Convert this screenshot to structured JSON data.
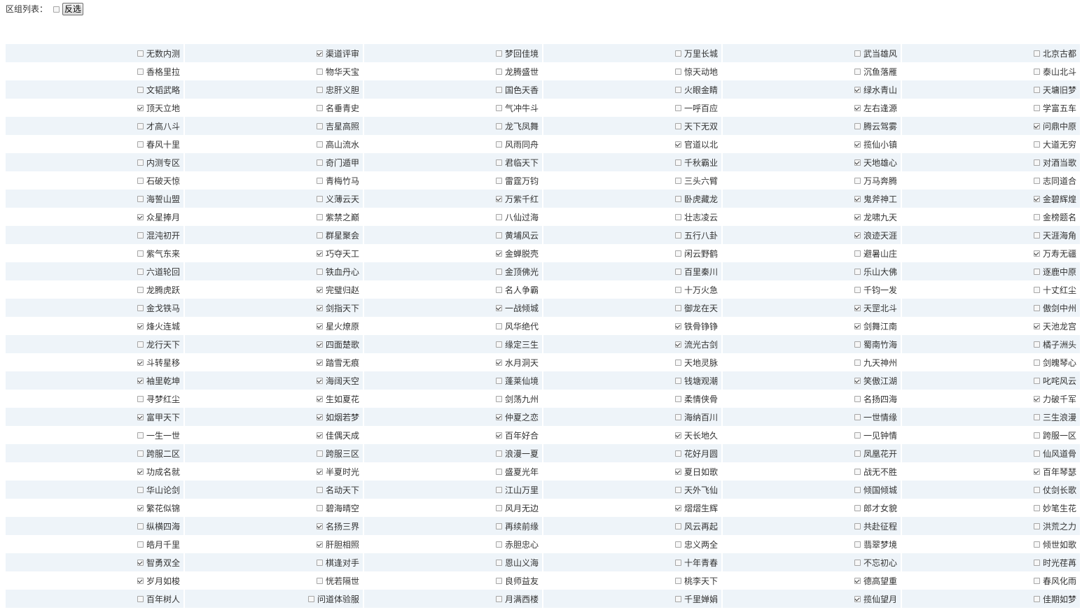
{
  "header": {
    "title": "区组列表：",
    "select_all_checked": false,
    "invert_button_label": "反选"
  },
  "rows": [
    [
      {
        "name": "无数内测",
        "checked": false
      },
      {
        "name": "渠道评审",
        "checked": true
      },
      {
        "name": "梦回佳境",
        "checked": false
      },
      {
        "name": "万里长城",
        "checked": false
      },
      {
        "name": "武当雄风",
        "checked": false
      },
      {
        "name": "北京古都",
        "checked": false
      }
    ],
    [
      {
        "name": "香格里拉",
        "checked": false
      },
      {
        "name": "物华天宝",
        "checked": false
      },
      {
        "name": "龙腾盛世",
        "checked": false
      },
      {
        "name": "惊天动地",
        "checked": false
      },
      {
        "name": "沉鱼落雁",
        "checked": false
      },
      {
        "name": "泰山北斗",
        "checked": false
      }
    ],
    [
      {
        "name": "文韬武略",
        "checked": false
      },
      {
        "name": "忠肝义胆",
        "checked": false
      },
      {
        "name": "国色天香",
        "checked": false
      },
      {
        "name": "火眼金睛",
        "checked": false
      },
      {
        "name": "绿水青山",
        "checked": true
      },
      {
        "name": "天墉旧梦",
        "checked": false
      }
    ],
    [
      {
        "name": "顶天立地",
        "checked": true
      },
      {
        "name": "名垂青史",
        "checked": false
      },
      {
        "name": "气冲牛斗",
        "checked": false
      },
      {
        "name": "一呼百应",
        "checked": false
      },
      {
        "name": "左右逢源",
        "checked": true
      },
      {
        "name": "学富五车",
        "checked": false
      }
    ],
    [
      {
        "name": "才高八斗",
        "checked": false
      },
      {
        "name": "吉星高照",
        "checked": false
      },
      {
        "name": "龙飞凤舞",
        "checked": false
      },
      {
        "name": "天下无双",
        "checked": false
      },
      {
        "name": "腾云驾雾",
        "checked": false
      },
      {
        "name": "问鼎中原",
        "checked": true
      }
    ],
    [
      {
        "name": "春风十里",
        "checked": false
      },
      {
        "name": "高山流水",
        "checked": false
      },
      {
        "name": "风雨同舟",
        "checked": false
      },
      {
        "name": "官道以北",
        "checked": true
      },
      {
        "name": "揽仙小镇",
        "checked": true
      },
      {
        "name": "大道无穷",
        "checked": false
      }
    ],
    [
      {
        "name": "内测专区",
        "checked": false
      },
      {
        "name": "奇门遁甲",
        "checked": false
      },
      {
        "name": "君临天下",
        "checked": false
      },
      {
        "name": "千秋霸业",
        "checked": false
      },
      {
        "name": "天地雄心",
        "checked": true
      },
      {
        "name": "对酒当歌",
        "checked": false
      }
    ],
    [
      {
        "name": "石破天惊",
        "checked": false
      },
      {
        "name": "青梅竹马",
        "checked": false
      },
      {
        "name": "雷霆万钧",
        "checked": false
      },
      {
        "name": "三头六臂",
        "checked": false
      },
      {
        "name": "万马奔腾",
        "checked": false
      },
      {
        "name": "志同道合",
        "checked": false
      }
    ],
    [
      {
        "name": "海誓山盟",
        "checked": false
      },
      {
        "name": "义薄云天",
        "checked": false
      },
      {
        "name": "万紫千红",
        "checked": true
      },
      {
        "name": "卧虎藏龙",
        "checked": false
      },
      {
        "name": "鬼斧神工",
        "checked": true
      },
      {
        "name": "金碧辉煌",
        "checked": true
      }
    ],
    [
      {
        "name": "众星捧月",
        "checked": true
      },
      {
        "name": "紫禁之巅",
        "checked": false
      },
      {
        "name": "八仙过海",
        "checked": false
      },
      {
        "name": "壮志凌云",
        "checked": false
      },
      {
        "name": "龙啸九天",
        "checked": true
      },
      {
        "name": "金榜题名",
        "checked": false
      }
    ],
    [
      {
        "name": "混沌初开",
        "checked": false
      },
      {
        "name": "群星聚会",
        "checked": false
      },
      {
        "name": "黄埔风云",
        "checked": false
      },
      {
        "name": "五行八卦",
        "checked": false
      },
      {
        "name": "浪迹天涯",
        "checked": true
      },
      {
        "name": "天涯海角",
        "checked": false
      }
    ],
    [
      {
        "name": "紫气东来",
        "checked": false
      },
      {
        "name": "巧夺天工",
        "checked": true
      },
      {
        "name": "金蝉脱壳",
        "checked": true
      },
      {
        "name": "闲云野鹤",
        "checked": false
      },
      {
        "name": "避暑山庄",
        "checked": false
      },
      {
        "name": "万寿无疆",
        "checked": true
      }
    ],
    [
      {
        "name": "六道轮回",
        "checked": false
      },
      {
        "name": "铁血丹心",
        "checked": false
      },
      {
        "name": "金顶佛光",
        "checked": false
      },
      {
        "name": "百里秦川",
        "checked": false
      },
      {
        "name": "乐山大佛",
        "checked": false
      },
      {
        "name": "逐鹿中原",
        "checked": false
      }
    ],
    [
      {
        "name": "龙腾虎跃",
        "checked": false
      },
      {
        "name": "完璧归赵",
        "checked": true
      },
      {
        "name": "名人争霸",
        "checked": false
      },
      {
        "name": "十万火急",
        "checked": false
      },
      {
        "name": "千钧一发",
        "checked": false
      },
      {
        "name": "十丈红尘",
        "checked": false
      }
    ],
    [
      {
        "name": "金戈铁马",
        "checked": false
      },
      {
        "name": "剑指天下",
        "checked": true
      },
      {
        "name": "一战倾城",
        "checked": true
      },
      {
        "name": "御龙在天",
        "checked": false
      },
      {
        "name": "天罡北斗",
        "checked": true
      },
      {
        "name": "傲剑中州",
        "checked": false
      }
    ],
    [
      {
        "name": "烽火连城",
        "checked": true
      },
      {
        "name": "星火燎原",
        "checked": true
      },
      {
        "name": "风华绝代",
        "checked": false
      },
      {
        "name": "铁骨铮铮",
        "checked": true
      },
      {
        "name": "剑舞江南",
        "checked": true
      },
      {
        "name": "天池龙宫",
        "checked": true
      }
    ],
    [
      {
        "name": "龙行天下",
        "checked": false
      },
      {
        "name": "四面楚歌",
        "checked": true
      },
      {
        "name": "缘定三生",
        "checked": false
      },
      {
        "name": "流光古剑",
        "checked": true
      },
      {
        "name": "蜀南竹海",
        "checked": false
      },
      {
        "name": "橘子洲头",
        "checked": false
      }
    ],
    [
      {
        "name": "斗转星移",
        "checked": true
      },
      {
        "name": "踏雪无痕",
        "checked": true
      },
      {
        "name": "水月洞天",
        "checked": true
      },
      {
        "name": "天地灵脉",
        "checked": false
      },
      {
        "name": "九天神州",
        "checked": false
      },
      {
        "name": "剑魄琴心",
        "checked": false
      }
    ],
    [
      {
        "name": "袖里乾坤",
        "checked": true
      },
      {
        "name": "海阔天空",
        "checked": true
      },
      {
        "name": "蓬莱仙境",
        "checked": false
      },
      {
        "name": "钱塘观潮",
        "checked": false
      },
      {
        "name": "笑傲江湖",
        "checked": true
      },
      {
        "name": "叱咤风云",
        "checked": false
      }
    ],
    [
      {
        "name": "寻梦红尘",
        "checked": false
      },
      {
        "name": "生如夏花",
        "checked": true
      },
      {
        "name": "剑荡九州",
        "checked": false
      },
      {
        "name": "柔情侠骨",
        "checked": false
      },
      {
        "name": "名扬四海",
        "checked": false
      },
      {
        "name": "力破千军",
        "checked": true
      }
    ],
    [
      {
        "name": "富甲天下",
        "checked": true
      },
      {
        "name": "如烟若梦",
        "checked": true
      },
      {
        "name": "仲夏之恋",
        "checked": true
      },
      {
        "name": "海纳百川",
        "checked": false
      },
      {
        "name": "一世情缘",
        "checked": false
      },
      {
        "name": "三生浪漫",
        "checked": false
      }
    ],
    [
      {
        "name": "一生一世",
        "checked": false
      },
      {
        "name": "佳偶天成",
        "checked": true
      },
      {
        "name": "百年好合",
        "checked": true
      },
      {
        "name": "天长地久",
        "checked": true
      },
      {
        "name": "一见钟情",
        "checked": false
      },
      {
        "name": "跨服一区",
        "checked": false
      }
    ],
    [
      {
        "name": "跨服二区",
        "checked": false
      },
      {
        "name": "跨服三区",
        "checked": false
      },
      {
        "name": "浪漫一夏",
        "checked": false
      },
      {
        "name": "花好月圆",
        "checked": false
      },
      {
        "name": "凤凰花开",
        "checked": false
      },
      {
        "name": "仙风道骨",
        "checked": false
      }
    ],
    [
      {
        "name": "功成名就",
        "checked": true
      },
      {
        "name": "半夏时光",
        "checked": true
      },
      {
        "name": "盛夏光年",
        "checked": false
      },
      {
        "name": "夏日如歌",
        "checked": true
      },
      {
        "name": "战无不胜",
        "checked": false
      },
      {
        "name": "百年琴瑟",
        "checked": true
      }
    ],
    [
      {
        "name": "华山论剑",
        "checked": false
      },
      {
        "name": "名动天下",
        "checked": false
      },
      {
        "name": "江山万里",
        "checked": false
      },
      {
        "name": "天外飞仙",
        "checked": false
      },
      {
        "name": "倾国倾城",
        "checked": false
      },
      {
        "name": "仗剑长歌",
        "checked": false
      }
    ],
    [
      {
        "name": "繁花似锦",
        "checked": true
      },
      {
        "name": "碧海晴空",
        "checked": false
      },
      {
        "name": "风月无边",
        "checked": false
      },
      {
        "name": "熠熠生辉",
        "checked": true
      },
      {
        "name": "郎才女貌",
        "checked": false
      },
      {
        "name": "妙笔生花",
        "checked": false
      }
    ],
    [
      {
        "name": "纵横四海",
        "checked": false
      },
      {
        "name": "名扬三界",
        "checked": true
      },
      {
        "name": "再续前缘",
        "checked": false
      },
      {
        "name": "风云再起",
        "checked": false
      },
      {
        "name": "共赴征程",
        "checked": false
      },
      {
        "name": "洪荒之力",
        "checked": false
      }
    ],
    [
      {
        "name": "皓月千里",
        "checked": false
      },
      {
        "name": "肝胆相照",
        "checked": true
      },
      {
        "name": "赤胆忠心",
        "checked": false
      },
      {
        "name": "忠义两全",
        "checked": false
      },
      {
        "name": "翡翠梦境",
        "checked": false
      },
      {
        "name": "倾世如歌",
        "checked": false
      }
    ],
    [
      {
        "name": "智勇双全",
        "checked": true
      },
      {
        "name": "棋逢对手",
        "checked": false
      },
      {
        "name": "恩山义海",
        "checked": false
      },
      {
        "name": "十年青春",
        "checked": false
      },
      {
        "name": "不忘初心",
        "checked": false
      },
      {
        "name": "时光荏苒",
        "checked": false
      }
    ],
    [
      {
        "name": "岁月如梭",
        "checked": true
      },
      {
        "name": "恍若隔世",
        "checked": false
      },
      {
        "name": "良师益友",
        "checked": false
      },
      {
        "name": "桃李天下",
        "checked": false
      },
      {
        "name": "德高望重",
        "checked": true
      },
      {
        "name": "春风化雨",
        "checked": false
      }
    ],
    [
      {
        "name": "百年树人",
        "checked": false
      },
      {
        "name": "问道体验服",
        "checked": false
      },
      {
        "name": "月满西楼",
        "checked": false
      },
      {
        "name": "千里婵娟",
        "checked": false
      },
      {
        "name": "揽仙望月",
        "checked": true
      },
      {
        "name": "佳期如梦",
        "checked": false
      }
    ]
  ]
}
